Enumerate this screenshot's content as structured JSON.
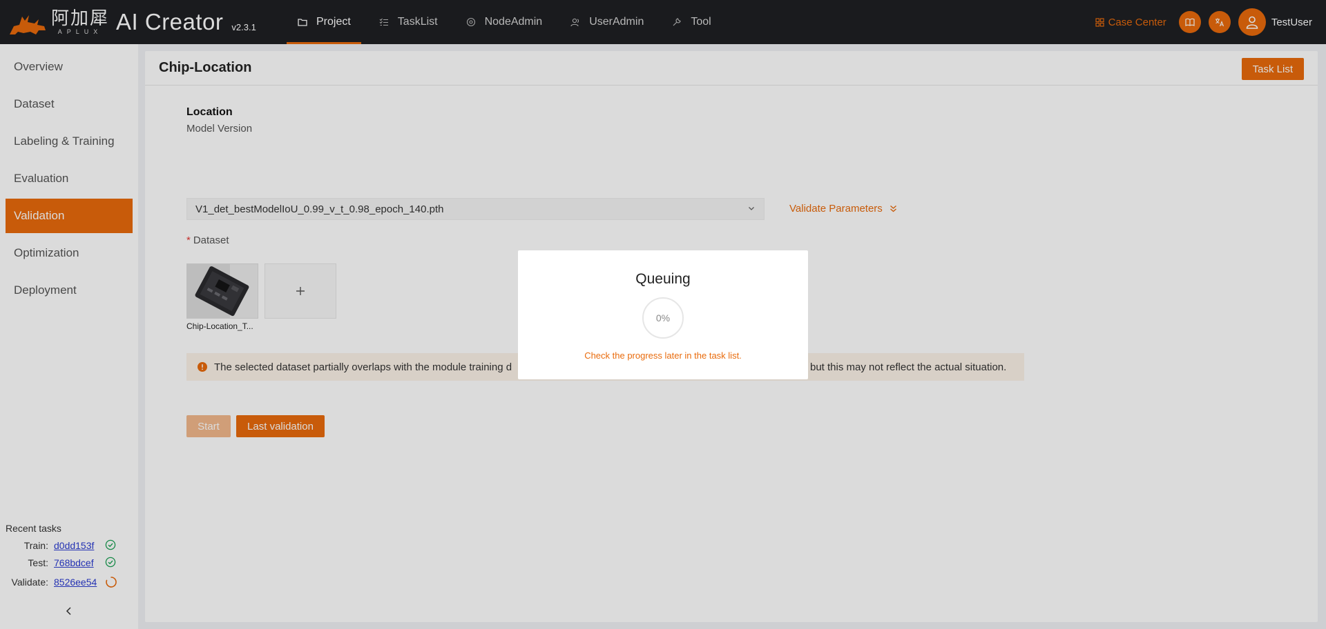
{
  "brand": {
    "cn_name": "阿加犀",
    "en_name": "APLUX",
    "product": "AI Creator",
    "version": "v2.3.1",
    "logo_icon": "aplux-logo-icon",
    "accent_color": "#e96b0c"
  },
  "nav": [
    {
      "label": "Project",
      "icon": "folder-icon",
      "active": true
    },
    {
      "label": "TaskList",
      "icon": "list-check-icon",
      "active": false
    },
    {
      "label": "NodeAdmin",
      "icon": "node-icon",
      "active": false
    },
    {
      "label": "UserAdmin",
      "icon": "users-icon",
      "active": false
    },
    {
      "label": "Tool",
      "icon": "wrench-icon",
      "active": false
    }
  ],
  "top_right": {
    "case_center": "Case Center",
    "username": "TestUser"
  },
  "sidebar": {
    "items": [
      {
        "label": "Overview",
        "active": false
      },
      {
        "label": "Dataset",
        "active": false
      },
      {
        "label": "Labeling & Training",
        "active": false
      },
      {
        "label": "Evaluation",
        "active": false
      },
      {
        "label": "Validation",
        "active": true
      },
      {
        "label": "Optimization",
        "active": false
      },
      {
        "label": "Deployment",
        "active": false
      }
    ],
    "recent": {
      "title": "Recent tasks",
      "rows": [
        {
          "label": "Train:",
          "id": "d0dd153f",
          "status": "success"
        },
        {
          "label": "Test:",
          "id": "768bdcef",
          "status": "success"
        },
        {
          "label": "Validate:",
          "id": "8526ee54",
          "status": "running"
        }
      ]
    }
  },
  "page": {
    "title": "Chip-Location",
    "task_list_button": "Task List",
    "section_title": "Location",
    "model_version_label": "Model Version",
    "model_version_value": "V1_det_bestModelIoU_0.99_v_t_0.98_epoch_140.pth",
    "validate_parameters": "Validate Parameters",
    "dataset_required_mark": "*",
    "dataset_label": "Dataset",
    "dataset_item_caption": "Chip-Location_T...",
    "add_symbol": "+",
    "warning_text_before": "The selected dataset partially overlaps with the module training d",
    "warning_text_after": "but this may not reflect the actual situation.",
    "start_button": "Start",
    "last_validation_button": "Last validation"
  },
  "modal": {
    "title": "Queuing",
    "progress_percent": 0,
    "progress_label": "0%",
    "hint": "Check the progress later in the task list."
  }
}
